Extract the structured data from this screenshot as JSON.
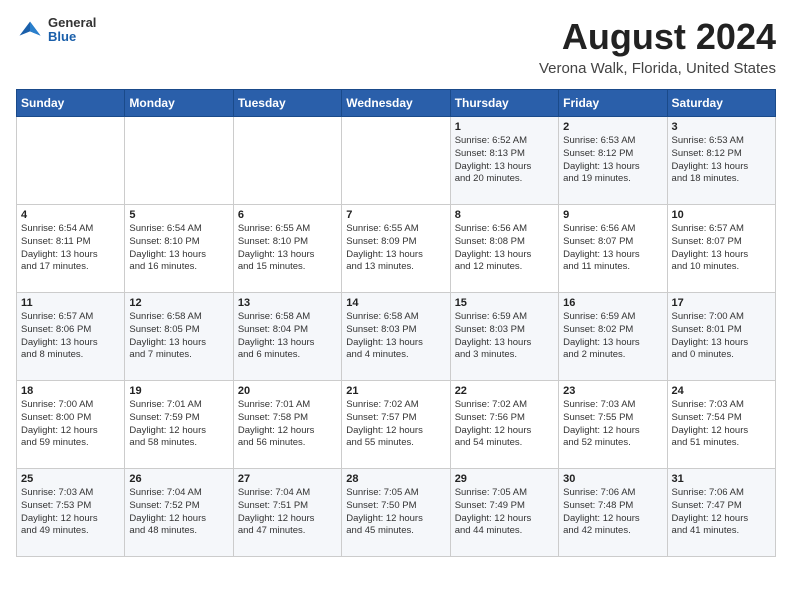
{
  "header": {
    "logo": {
      "general": "General",
      "blue": "Blue"
    },
    "title": "August 2024",
    "location": "Verona Walk, Florida, United States"
  },
  "weekdays": [
    "Sunday",
    "Monday",
    "Tuesday",
    "Wednesday",
    "Thursday",
    "Friday",
    "Saturday"
  ],
  "weeks": [
    [
      {
        "day": "",
        "content": ""
      },
      {
        "day": "",
        "content": ""
      },
      {
        "day": "",
        "content": ""
      },
      {
        "day": "",
        "content": ""
      },
      {
        "day": "1",
        "content": "Sunrise: 6:52 AM\nSunset: 8:13 PM\nDaylight: 13 hours\nand 20 minutes."
      },
      {
        "day": "2",
        "content": "Sunrise: 6:53 AM\nSunset: 8:12 PM\nDaylight: 13 hours\nand 19 minutes."
      },
      {
        "day": "3",
        "content": "Sunrise: 6:53 AM\nSunset: 8:12 PM\nDaylight: 13 hours\nand 18 minutes."
      }
    ],
    [
      {
        "day": "4",
        "content": "Sunrise: 6:54 AM\nSunset: 8:11 PM\nDaylight: 13 hours\nand 17 minutes."
      },
      {
        "day": "5",
        "content": "Sunrise: 6:54 AM\nSunset: 8:10 PM\nDaylight: 13 hours\nand 16 minutes."
      },
      {
        "day": "6",
        "content": "Sunrise: 6:55 AM\nSunset: 8:10 PM\nDaylight: 13 hours\nand 15 minutes."
      },
      {
        "day": "7",
        "content": "Sunrise: 6:55 AM\nSunset: 8:09 PM\nDaylight: 13 hours\nand 13 minutes."
      },
      {
        "day": "8",
        "content": "Sunrise: 6:56 AM\nSunset: 8:08 PM\nDaylight: 13 hours\nand 12 minutes."
      },
      {
        "day": "9",
        "content": "Sunrise: 6:56 AM\nSunset: 8:07 PM\nDaylight: 13 hours\nand 11 minutes."
      },
      {
        "day": "10",
        "content": "Sunrise: 6:57 AM\nSunset: 8:07 PM\nDaylight: 13 hours\nand 10 minutes."
      }
    ],
    [
      {
        "day": "11",
        "content": "Sunrise: 6:57 AM\nSunset: 8:06 PM\nDaylight: 13 hours\nand 8 minutes."
      },
      {
        "day": "12",
        "content": "Sunrise: 6:58 AM\nSunset: 8:05 PM\nDaylight: 13 hours\nand 7 minutes."
      },
      {
        "day": "13",
        "content": "Sunrise: 6:58 AM\nSunset: 8:04 PM\nDaylight: 13 hours\nand 6 minutes."
      },
      {
        "day": "14",
        "content": "Sunrise: 6:58 AM\nSunset: 8:03 PM\nDaylight: 13 hours\nand 4 minutes."
      },
      {
        "day": "15",
        "content": "Sunrise: 6:59 AM\nSunset: 8:03 PM\nDaylight: 13 hours\nand 3 minutes."
      },
      {
        "day": "16",
        "content": "Sunrise: 6:59 AM\nSunset: 8:02 PM\nDaylight: 13 hours\nand 2 minutes."
      },
      {
        "day": "17",
        "content": "Sunrise: 7:00 AM\nSunset: 8:01 PM\nDaylight: 13 hours\nand 0 minutes."
      }
    ],
    [
      {
        "day": "18",
        "content": "Sunrise: 7:00 AM\nSunset: 8:00 PM\nDaylight: 12 hours\nand 59 minutes."
      },
      {
        "day": "19",
        "content": "Sunrise: 7:01 AM\nSunset: 7:59 PM\nDaylight: 12 hours\nand 58 minutes."
      },
      {
        "day": "20",
        "content": "Sunrise: 7:01 AM\nSunset: 7:58 PM\nDaylight: 12 hours\nand 56 minutes."
      },
      {
        "day": "21",
        "content": "Sunrise: 7:02 AM\nSunset: 7:57 PM\nDaylight: 12 hours\nand 55 minutes."
      },
      {
        "day": "22",
        "content": "Sunrise: 7:02 AM\nSunset: 7:56 PM\nDaylight: 12 hours\nand 54 minutes."
      },
      {
        "day": "23",
        "content": "Sunrise: 7:03 AM\nSunset: 7:55 PM\nDaylight: 12 hours\nand 52 minutes."
      },
      {
        "day": "24",
        "content": "Sunrise: 7:03 AM\nSunset: 7:54 PM\nDaylight: 12 hours\nand 51 minutes."
      }
    ],
    [
      {
        "day": "25",
        "content": "Sunrise: 7:03 AM\nSunset: 7:53 PM\nDaylight: 12 hours\nand 49 minutes."
      },
      {
        "day": "26",
        "content": "Sunrise: 7:04 AM\nSunset: 7:52 PM\nDaylight: 12 hours\nand 48 minutes."
      },
      {
        "day": "27",
        "content": "Sunrise: 7:04 AM\nSunset: 7:51 PM\nDaylight: 12 hours\nand 47 minutes."
      },
      {
        "day": "28",
        "content": "Sunrise: 7:05 AM\nSunset: 7:50 PM\nDaylight: 12 hours\nand 45 minutes."
      },
      {
        "day": "29",
        "content": "Sunrise: 7:05 AM\nSunset: 7:49 PM\nDaylight: 12 hours\nand 44 minutes."
      },
      {
        "day": "30",
        "content": "Sunrise: 7:06 AM\nSunset: 7:48 PM\nDaylight: 12 hours\nand 42 minutes."
      },
      {
        "day": "31",
        "content": "Sunrise: 7:06 AM\nSunset: 7:47 PM\nDaylight: 12 hours\nand 41 minutes."
      }
    ]
  ]
}
